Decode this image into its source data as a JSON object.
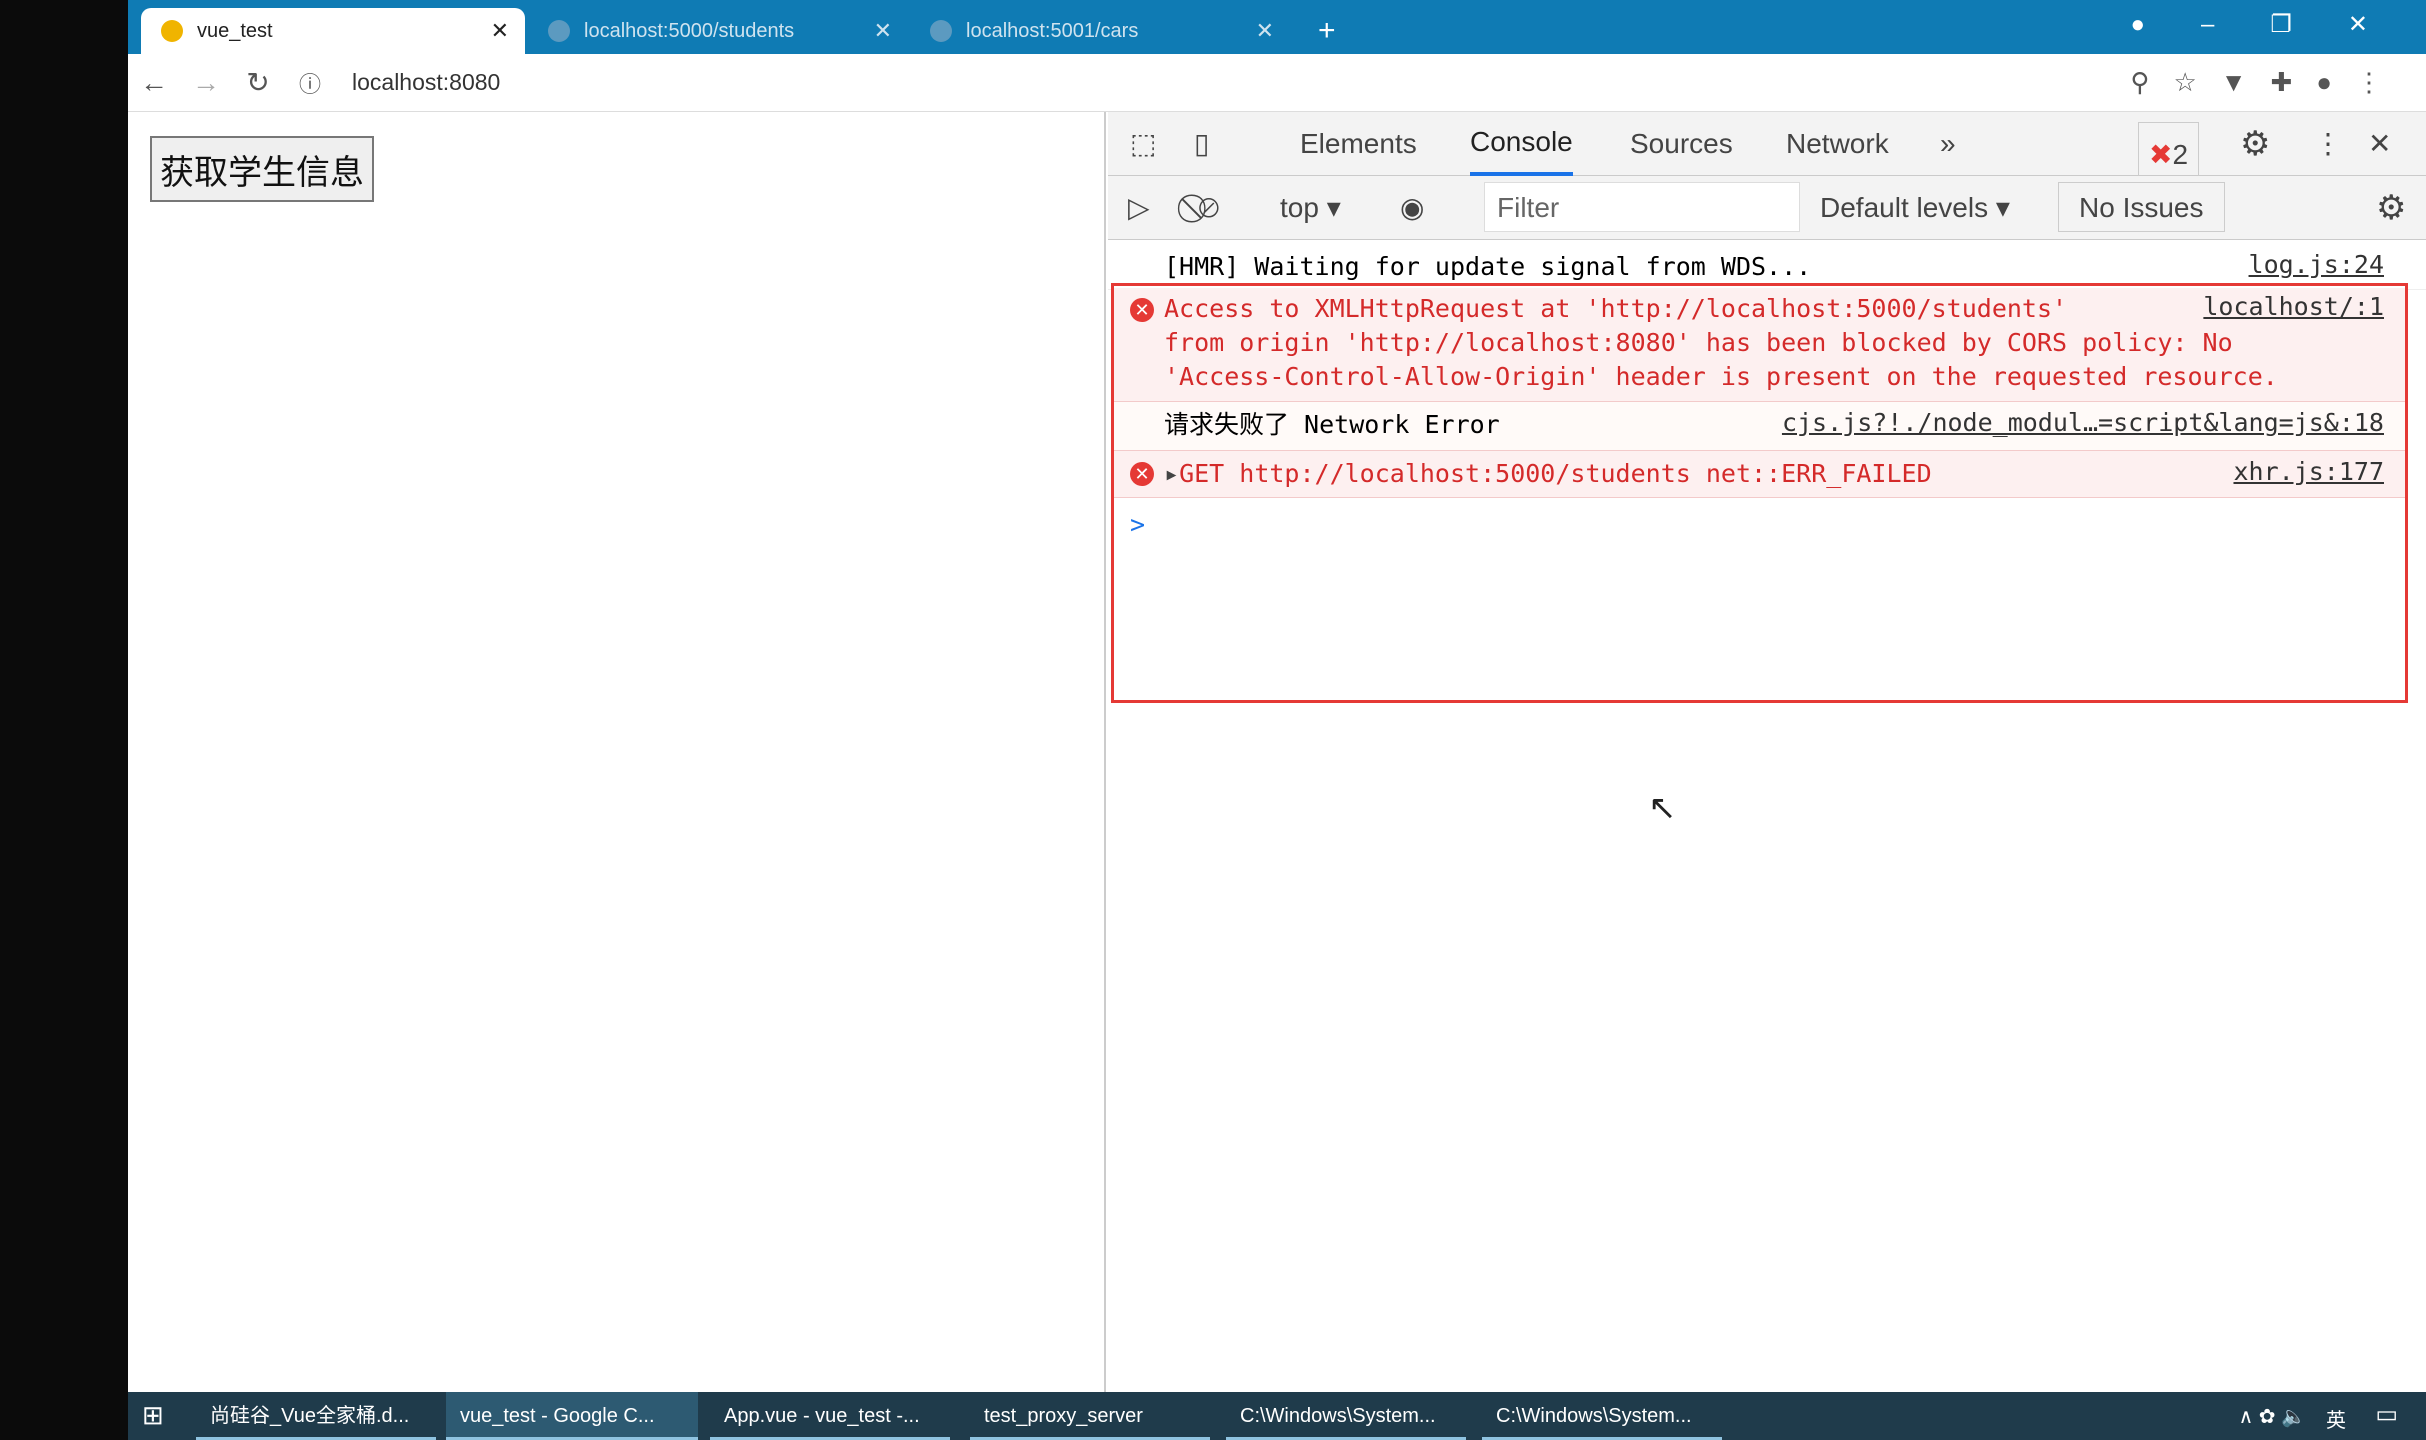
{
  "browser": {
    "tabs": [
      {
        "title": "vue_test",
        "active": true
      },
      {
        "title": "localhost:5000/students"
      },
      {
        "title": "localhost:5001/cars"
      }
    ],
    "new_tab": "+",
    "url": "localhost:8080"
  },
  "page": {
    "button_label": "获取学生信息"
  },
  "devtools": {
    "tabs": [
      "Elements",
      "Console",
      "Sources",
      "Network"
    ],
    "active_tab": "Console",
    "more": "»",
    "error_count": "2",
    "context": "top",
    "filter_placeholder": "Filter",
    "levels": "Default levels",
    "issues": "No Issues",
    "messages": [
      {
        "type": "log",
        "text": "[HMR] Waiting for update signal from WDS...",
        "source": "log.js:24"
      },
      {
        "type": "error",
        "lines": [
          "Access to XMLHttpRequest at 'http://localhost:5000/students'",
          "from origin 'http://localhost:8080' has been blocked by CORS policy: No",
          "'Access-Control-Allow-Origin' header is present on the requested resource."
        ],
        "source": "localhost/:1"
      },
      {
        "type": "log",
        "text": "请求失败了 Network Error",
        "source": "cjs.js?!./node_modul…=script&lang=js&:18"
      },
      {
        "type": "error",
        "text": "GET http://localhost:5000/students net::ERR_FAILED",
        "source": "xhr.js:177"
      }
    ],
    "prompt": ">"
  },
  "taskbar": {
    "items": [
      "尚硅谷_Vue全家桶.d...",
      "vue_test - Google C...",
      "App.vue - vue_test -...",
      "test_proxy_server",
      "C:\\Windows\\System...",
      "C:\\Windows\\System..."
    ],
    "ime": "英"
  },
  "colors": {
    "accent": "#0f7bb4",
    "error": "#d42a2a",
    "highlight_box": "#e53935"
  }
}
